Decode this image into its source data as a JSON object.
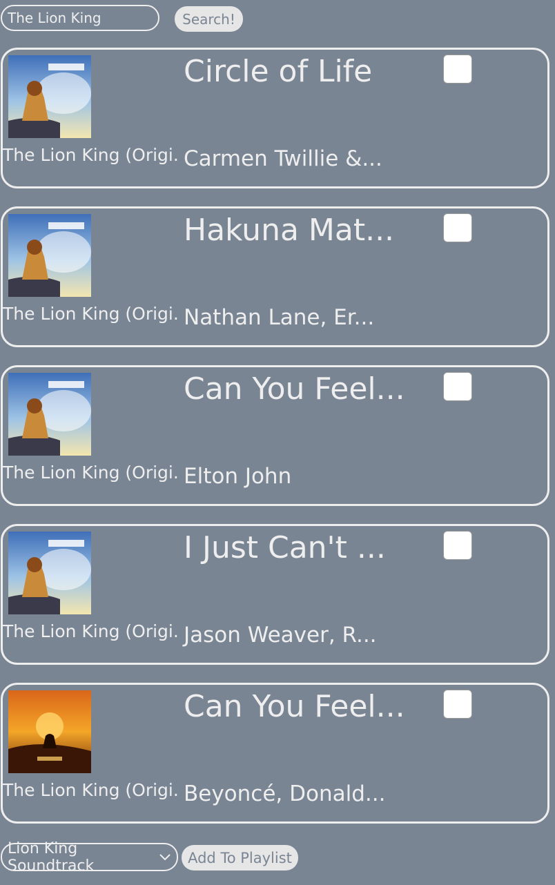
{
  "search": {
    "value": "The Lion King",
    "button_label": "Search!"
  },
  "results": [
    {
      "album": "The Lion King (Origi...",
      "title": "Circle of Life",
      "artist": "Carmen Twillie &...",
      "checked": false,
      "art": "classic-lion-king-cover"
    },
    {
      "album": "The Lion King (Origi...",
      "title": "Hakuna Mat...",
      "artist": "Nathan Lane, Er...",
      "checked": false,
      "art": "classic-lion-king-cover"
    },
    {
      "album": "The Lion King (Origi...",
      "title": "Can You Feel...",
      "artist": "Elton John",
      "checked": false,
      "art": "classic-lion-king-cover"
    },
    {
      "album": "The Lion King (Origi...",
      "title": "I Just Can't ...",
      "artist": "Jason Weaver, R...",
      "checked": false,
      "art": "classic-lion-king-cover"
    },
    {
      "album": "The Lion King (Origi...",
      "title": "Can You Feel...",
      "artist": "Beyoncé, Donald...",
      "checked": false,
      "art": "remake-lion-king-cover"
    }
  ],
  "playlist": {
    "selected": "Lion King Soundtrack",
    "add_button_label": "Add To Playlist"
  },
  "colors": {
    "background": "#7a8594",
    "text": "#eeeeee",
    "button": "#e6e6e6"
  }
}
